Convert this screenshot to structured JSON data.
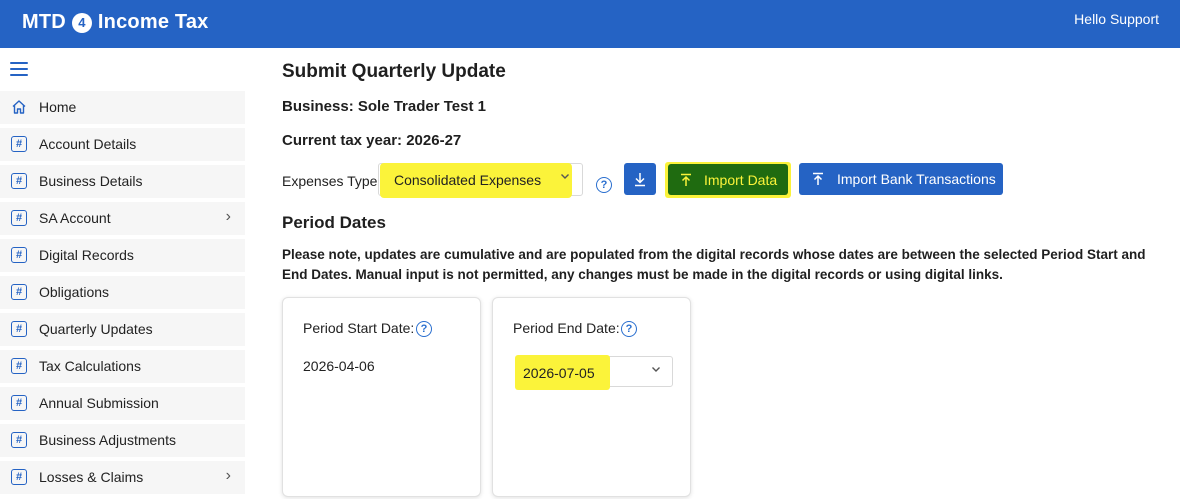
{
  "app": {
    "brand_left": "MTD",
    "brand_badge": "4",
    "brand_right": "Income Tax",
    "greeting": "Hello Support"
  },
  "sidebar": {
    "items": [
      {
        "label": "Home",
        "icon": "home-icon",
        "has_submenu": false
      },
      {
        "label": "Account Details",
        "icon": "hash-icon",
        "has_submenu": false
      },
      {
        "label": "Business Details",
        "icon": "hash-icon",
        "has_submenu": false
      },
      {
        "label": "SA Account",
        "icon": "hash-icon",
        "has_submenu": true
      },
      {
        "label": "Digital Records",
        "icon": "hash-icon",
        "has_submenu": false
      },
      {
        "label": "Obligations",
        "icon": "hash-icon",
        "has_submenu": false
      },
      {
        "label": "Quarterly Updates",
        "icon": "hash-icon",
        "has_submenu": false
      },
      {
        "label": "Tax Calculations",
        "icon": "hash-icon",
        "has_submenu": false
      },
      {
        "label": "Annual Submission",
        "icon": "hash-icon",
        "has_submenu": false
      },
      {
        "label": "Business Adjustments",
        "icon": "hash-icon",
        "has_submenu": false
      },
      {
        "label": "Losses & Claims",
        "icon": "hash-icon",
        "has_submenu": true
      }
    ]
  },
  "main": {
    "title": "Submit Quarterly Update",
    "business": "Business: Sole Trader Test 1",
    "tax_year": "Current tax year: 2026-27",
    "expenses_label": "Expenses Type:",
    "expenses_value": "Consolidated Expenses",
    "import_data_label": "Import Data",
    "import_bank_label": "Import Bank Transactions",
    "period_heading": "Period Dates",
    "note": "Please note, updates are cumulative and are populated from the digital records whose dates are between the selected Period Start and End Dates. Manual input is not permitted, any changes must be made in the digital records or using digital links.",
    "start_label": "Period Start Date:",
    "start_value": "2026-04-06",
    "end_label": "Period End Date:",
    "end_value": "2026-07-05",
    "help_glyph": "?"
  },
  "colors": {
    "header": "#2563c4",
    "highlight": "#fbf33a",
    "import_button": "#1f6b10"
  }
}
